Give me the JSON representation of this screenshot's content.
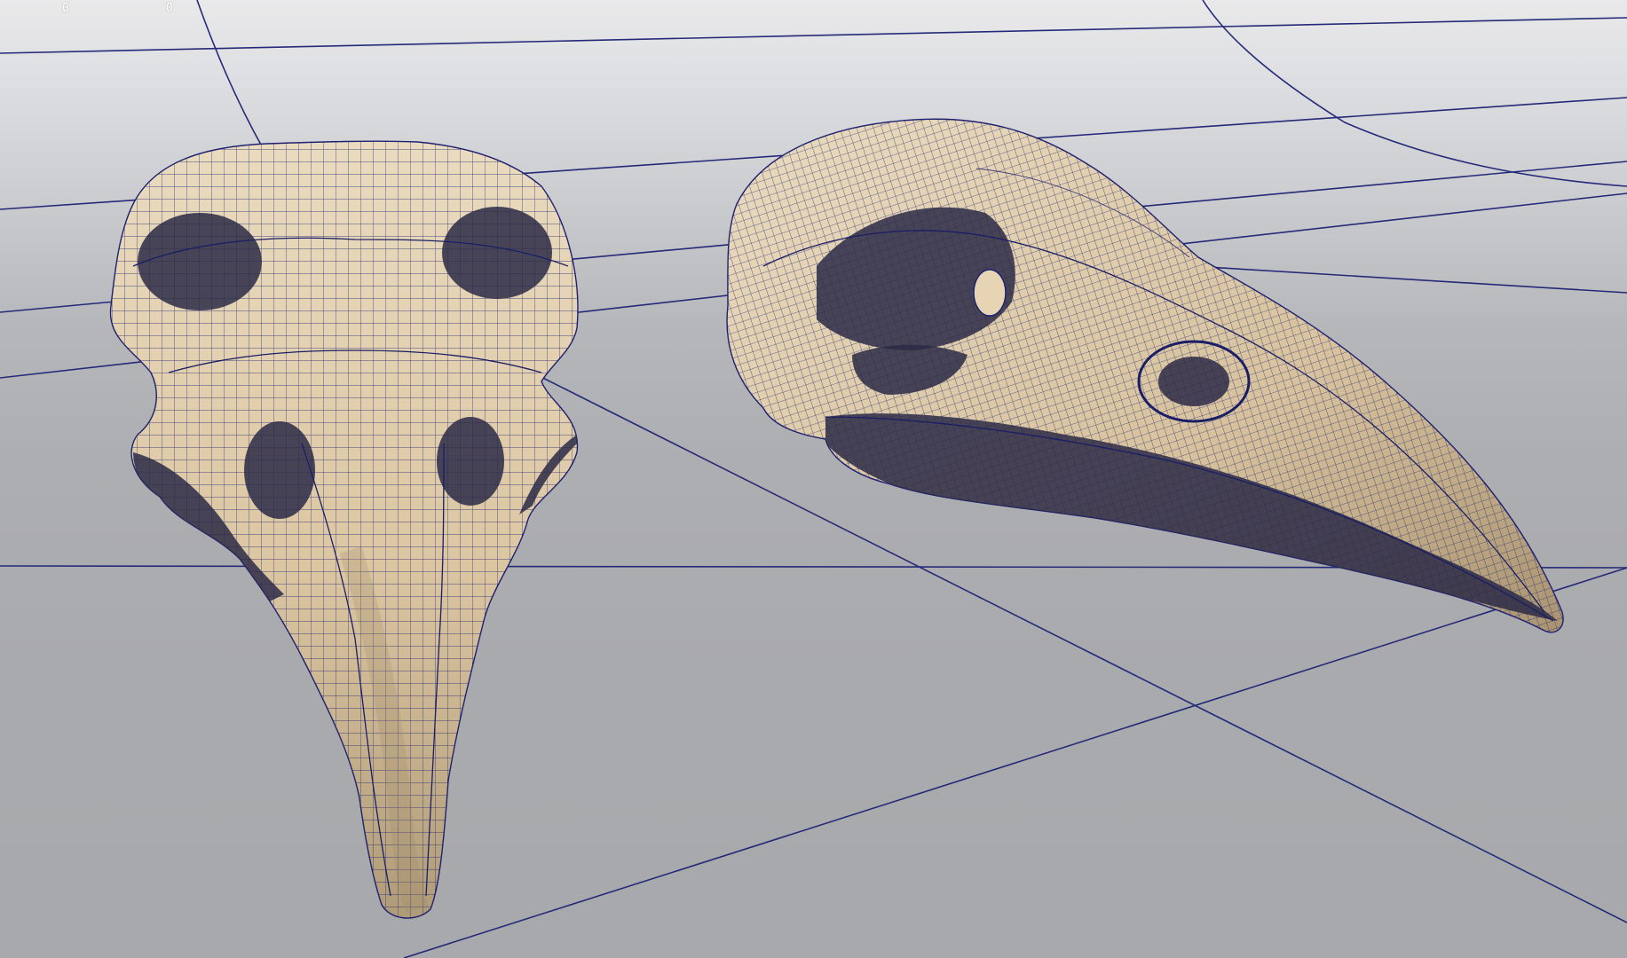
{
  "viewport": {
    "hud_counters": [
      "0",
      "0"
    ],
    "objects": [
      {
        "name": "bird-skull-front-view",
        "icon": "mesh-object-icon"
      },
      {
        "name": "bird-skull-side-view",
        "icon": "mesh-object-icon"
      }
    ],
    "colors": {
      "background_top": "#e9e9ea",
      "background_bottom": "#a8a9ac",
      "grid_line": "#252a78",
      "wireframe": "#1f2472",
      "bone_light": "#e8d6b8",
      "bone_shadow": "#9c8a6c"
    }
  }
}
